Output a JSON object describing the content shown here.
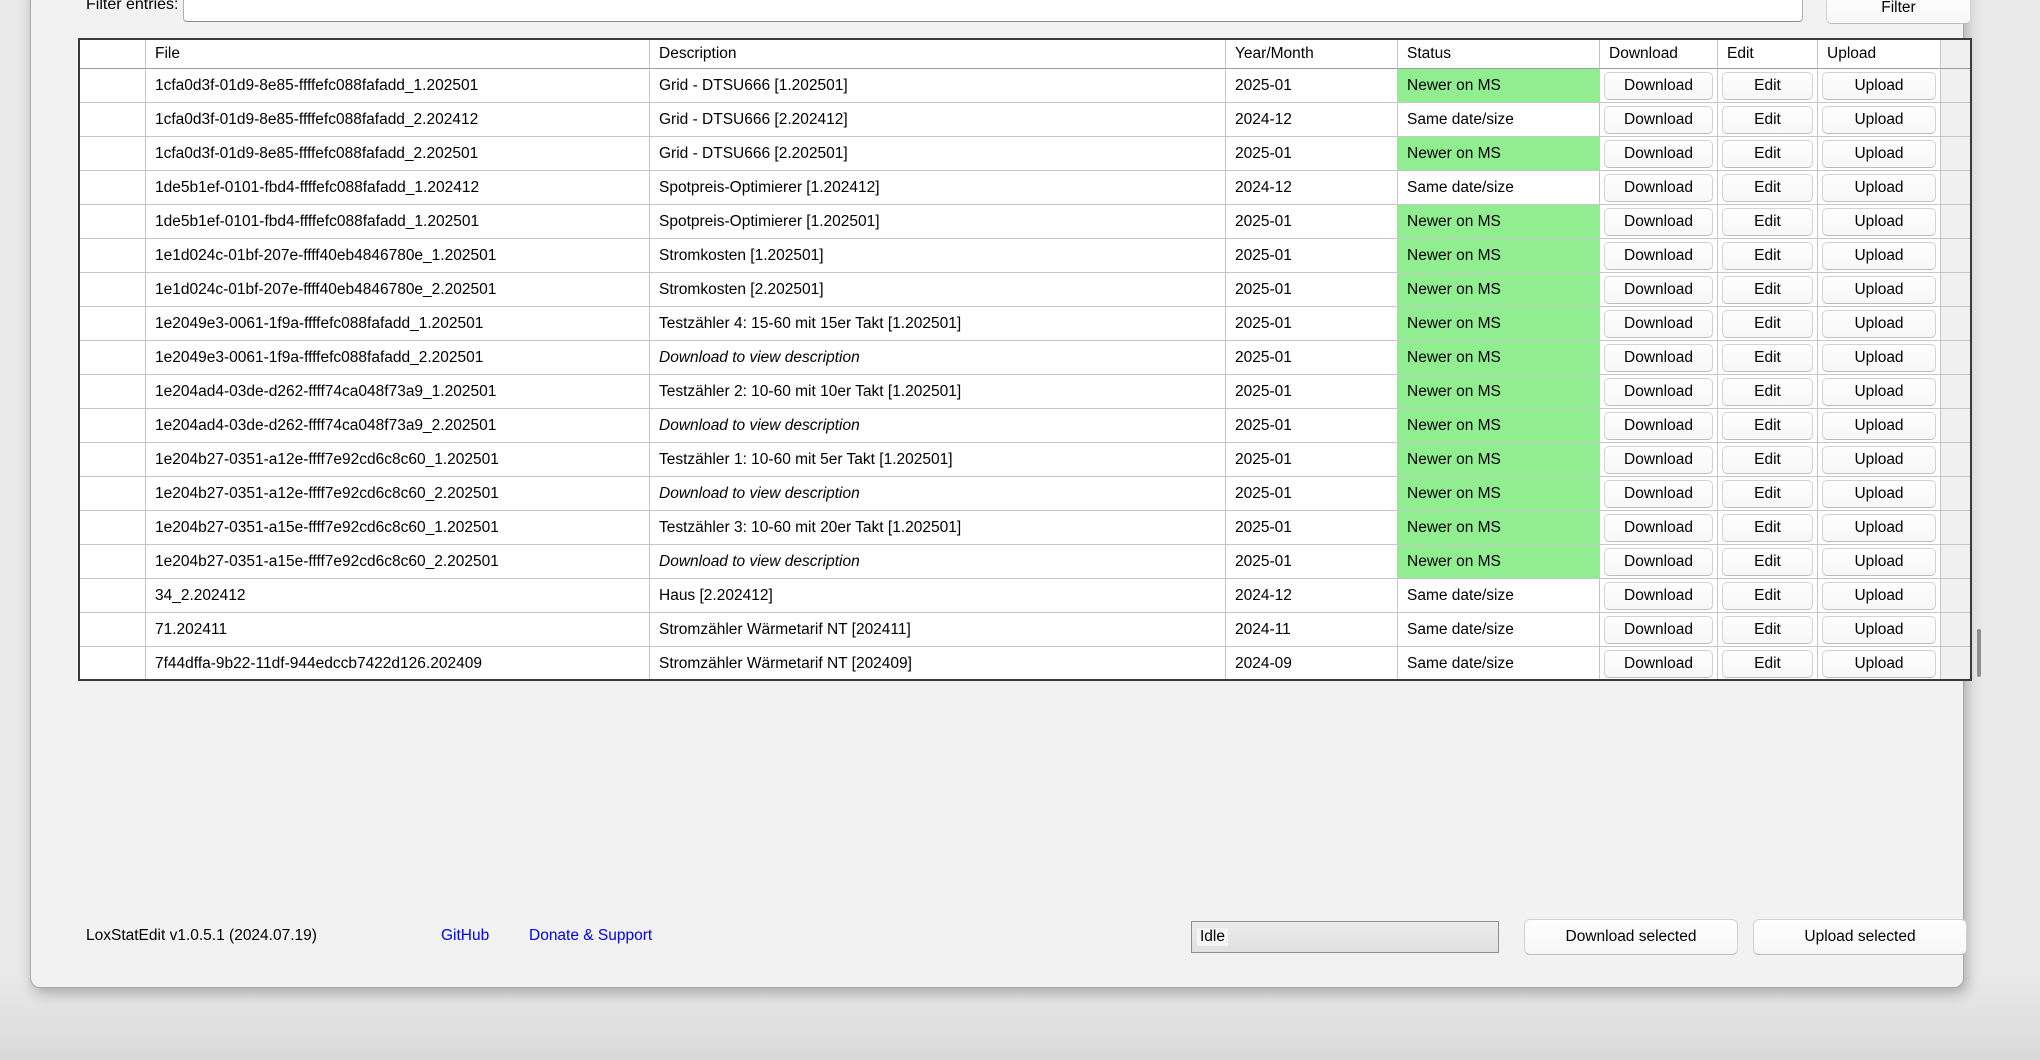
{
  "filter": {
    "label": "Filter entries:",
    "value": "",
    "button_label": "Filter"
  },
  "table": {
    "columns": [
      "",
      "File",
      "Description",
      "Year/Month",
      "Status",
      "Download",
      "Edit",
      "Upload"
    ],
    "row_button_labels": {
      "download": "Download",
      "edit": "Edit",
      "upload": "Upload"
    },
    "status_colors": {
      "Newer on MS": "#90EE90",
      "Same date/size": "#FFFFFF"
    },
    "placeholder_description": "Download to view description",
    "rows": [
      {
        "file": "1cfa0d3f-01d9-8e85-ffffefc088fafadd_1.202501",
        "description": "Grid - DTSU666 [1.202501]",
        "desc_italic": false,
        "year_month": "2025-01",
        "status": "Newer on MS"
      },
      {
        "file": "1cfa0d3f-01d9-8e85-ffffefc088fafadd_2.202412",
        "description": "Grid - DTSU666 [2.202412]",
        "desc_italic": false,
        "year_month": "2024-12",
        "status": "Same date/size"
      },
      {
        "file": "1cfa0d3f-01d9-8e85-ffffefc088fafadd_2.202501",
        "description": "Grid - DTSU666 [2.202501]",
        "desc_italic": false,
        "year_month": "2025-01",
        "status": "Newer on MS"
      },
      {
        "file": "1de5b1ef-0101-fbd4-ffffefc088fafadd_1.202412",
        "description": "Spotpreis-Optimierer [1.202412]",
        "desc_italic": false,
        "year_month": "2024-12",
        "status": "Same date/size"
      },
      {
        "file": "1de5b1ef-0101-fbd4-ffffefc088fafadd_1.202501",
        "description": "Spotpreis-Optimierer [1.202501]",
        "desc_italic": false,
        "year_month": "2025-01",
        "status": "Newer on MS"
      },
      {
        "file": "1e1d024c-01bf-207e-ffff40eb4846780e_1.202501",
        "description": "Stromkosten [1.202501]",
        "desc_italic": false,
        "year_month": "2025-01",
        "status": "Newer on MS"
      },
      {
        "file": "1e1d024c-01bf-207e-ffff40eb4846780e_2.202501",
        "description": "Stromkosten [2.202501]",
        "desc_italic": false,
        "year_month": "2025-01",
        "status": "Newer on MS"
      },
      {
        "file": "1e2049e3-0061-1f9a-ffffefc088fafadd_1.202501",
        "description": "Testzähler 4: 15-60 mit 15er Takt [1.202501]",
        "desc_italic": false,
        "year_month": "2025-01",
        "status": "Newer on MS"
      },
      {
        "file": "1e2049e3-0061-1f9a-ffffefc088fafadd_2.202501",
        "description": "Download to view description",
        "desc_italic": true,
        "year_month": "2025-01",
        "status": "Newer on MS"
      },
      {
        "file": "1e204ad4-03de-d262-ffff74ca048f73a9_1.202501",
        "description": "Testzähler 2: 10-60 mit 10er Takt [1.202501]",
        "desc_italic": false,
        "year_month": "2025-01",
        "status": "Newer on MS"
      },
      {
        "file": "1e204ad4-03de-d262-ffff74ca048f73a9_2.202501",
        "description": "Download to view description",
        "desc_italic": true,
        "year_month": "2025-01",
        "status": "Newer on MS"
      },
      {
        "file": "1e204b27-0351-a12e-ffff7e92cd6c8c60_1.202501",
        "description": "Testzähler 1: 10-60 mit 5er Takt [1.202501]",
        "desc_italic": false,
        "year_month": "2025-01",
        "status": "Newer on MS"
      },
      {
        "file": "1e204b27-0351-a12e-ffff7e92cd6c8c60_2.202501",
        "description": "Download to view description",
        "desc_italic": true,
        "year_month": "2025-01",
        "status": "Newer on MS"
      },
      {
        "file": "1e204b27-0351-a15e-ffff7e92cd6c8c60_1.202501",
        "description": "Testzähler 3: 10-60 mit 20er Takt [1.202501]",
        "desc_italic": false,
        "year_month": "2025-01",
        "status": "Newer on MS"
      },
      {
        "file": "1e204b27-0351-a15e-ffff7e92cd6c8c60_2.202501",
        "description": "Download to view description",
        "desc_italic": true,
        "year_month": "2025-01",
        "status": "Newer on MS"
      },
      {
        "file": "34_2.202412",
        "description": "Haus [2.202412]",
        "desc_italic": false,
        "year_month": "2024-12",
        "status": "Same date/size"
      },
      {
        "file": "71.202411",
        "description": "Stromzähler Wärmetarif NT [202411]",
        "desc_italic": false,
        "year_month": "2024-11",
        "status": "Same date/size"
      },
      {
        "file": "7f44dffa-9b22-11df-944edccb7422d126.202409",
        "description": "Stromzähler Wärmetarif NT [202409]",
        "desc_italic": false,
        "year_month": "2024-09",
        "status": "Same date/size"
      }
    ]
  },
  "footer": {
    "version_text": "LoxStatEdit v1.0.5.1 (2024.07.19)",
    "github_label": "GitHub",
    "donate_label": "Donate & Support",
    "progress_status": "Idle",
    "download_selected_label": "Download selected",
    "upload_selected_label": "Upload selected"
  }
}
